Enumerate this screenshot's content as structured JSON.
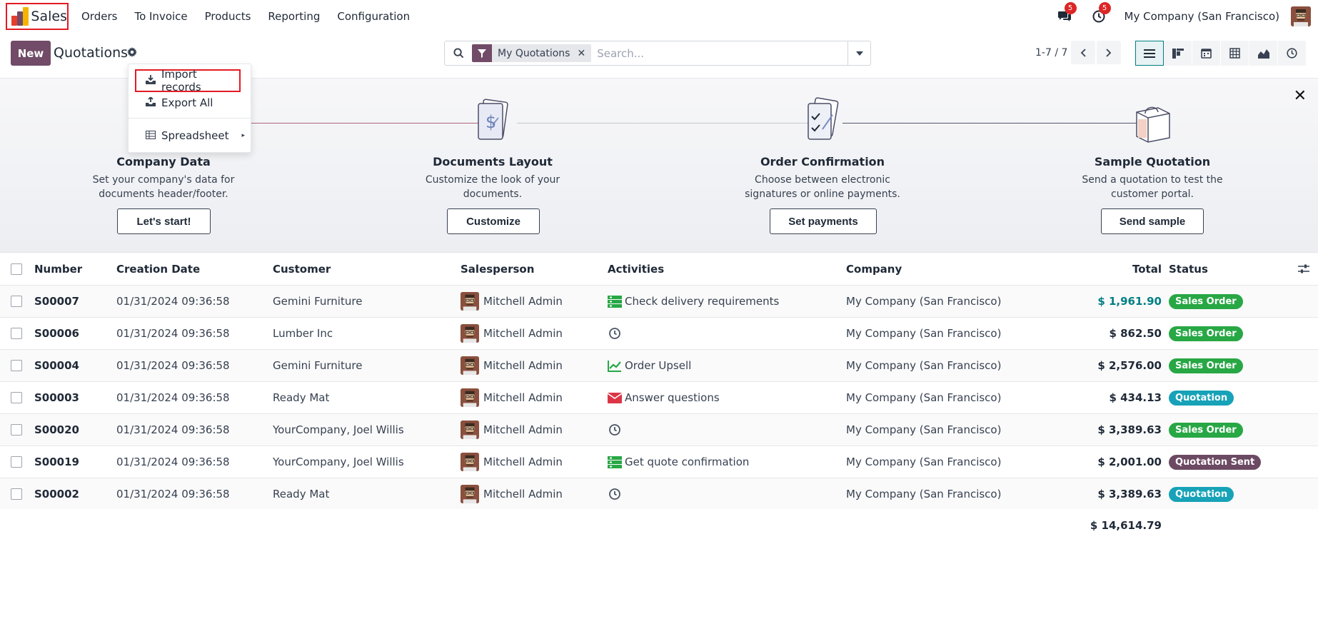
{
  "app": {
    "name": "Sales"
  },
  "nav": {
    "menu": [
      "Orders",
      "To Invoice",
      "Products",
      "Reporting",
      "Configuration"
    ],
    "chat_count": "5",
    "activity_count": "5",
    "company": "My Company (San Francisco)"
  },
  "control": {
    "new_label": "New",
    "breadcrumb": "Quotations",
    "search": {
      "facet": "My Quotations",
      "placeholder": "Search..."
    },
    "pager": "1-7 / 7"
  },
  "gear_menu": {
    "import": "Import records",
    "export": "Export All",
    "spreadsheet": "Spreadsheet"
  },
  "onboarding": {
    "steps": [
      {
        "title": "Company Data",
        "desc": "Set your company's data for documents header/footer.",
        "button": "Let's start!"
      },
      {
        "title": "Documents Layout",
        "desc": "Customize the look of your documents.",
        "button": "Customize"
      },
      {
        "title": "Order Confirmation",
        "desc": "Choose between electronic signatures or online payments.",
        "button": "Set payments"
      },
      {
        "title": "Sample Quotation",
        "desc": "Send a quotation to test the customer portal.",
        "button": "Send sample"
      }
    ]
  },
  "table": {
    "columns": [
      "Number",
      "Creation Date",
      "Customer",
      "Salesperson",
      "Activities",
      "Company",
      "Total",
      "Status"
    ],
    "rows": [
      {
        "number": "S00007",
        "date": "01/31/2024 09:36:58",
        "customer": "Gemini Furniture",
        "salesperson": "Mitchell Admin",
        "activity": "Check delivery requirements",
        "activity_icon": "tasks-icon",
        "company": "My Company (San Francisco)",
        "total": "$ 1,961.90",
        "status": "Sales Order"
      },
      {
        "number": "S00006",
        "date": "01/31/2024 09:36:58",
        "customer": "Lumber Inc",
        "salesperson": "Mitchell Admin",
        "activity": "",
        "activity_icon": "clock-icon",
        "company": "My Company (San Francisco)",
        "total": "$ 862.50",
        "status": "Sales Order"
      },
      {
        "number": "S00004",
        "date": "01/31/2024 09:36:58",
        "customer": "Gemini Furniture",
        "salesperson": "Mitchell Admin",
        "activity": "Order Upsell",
        "activity_icon": "chart-line-icon",
        "company": "My Company (San Francisco)",
        "total": "$ 2,576.00",
        "status": "Sales Order"
      },
      {
        "number": "S00003",
        "date": "01/31/2024 09:36:58",
        "customer": "Ready Mat",
        "salesperson": "Mitchell Admin",
        "activity": "Answer questions",
        "activity_icon": "envelope-icon",
        "company": "My Company (San Francisco)",
        "total": "$ 434.13",
        "status": "Quotation"
      },
      {
        "number": "S00020",
        "date": "01/31/2024 09:36:58",
        "customer": "YourCompany, Joel Willis",
        "salesperson": "Mitchell Admin",
        "activity": "",
        "activity_icon": "clock-icon",
        "company": "My Company (San Francisco)",
        "total": "$ 3,389.63",
        "status": "Sales Order"
      },
      {
        "number": "S00019",
        "date": "01/31/2024 09:36:58",
        "customer": "YourCompany, Joel Willis",
        "salesperson": "Mitchell Admin",
        "activity": "Get quote confirmation",
        "activity_icon": "tasks-icon",
        "company": "My Company (San Francisco)",
        "total": "$ 2,001.00",
        "status": "Quotation Sent"
      },
      {
        "number": "S00002",
        "date": "01/31/2024 09:36:58",
        "customer": "Ready Mat",
        "salesperson": "Mitchell Admin",
        "activity": "",
        "activity_icon": "clock-icon",
        "company": "My Company (San Francisco)",
        "total": "$ 3,389.63",
        "status": "Quotation"
      }
    ],
    "grand_total": "$ 14,614.79"
  },
  "colors": {
    "primary": "#714b67",
    "accent": "#017e84",
    "sales_order": "#28a745",
    "quotation": "#17a2b8",
    "quotation_sent": "#6c4a63",
    "highlight": "#e21b23"
  }
}
